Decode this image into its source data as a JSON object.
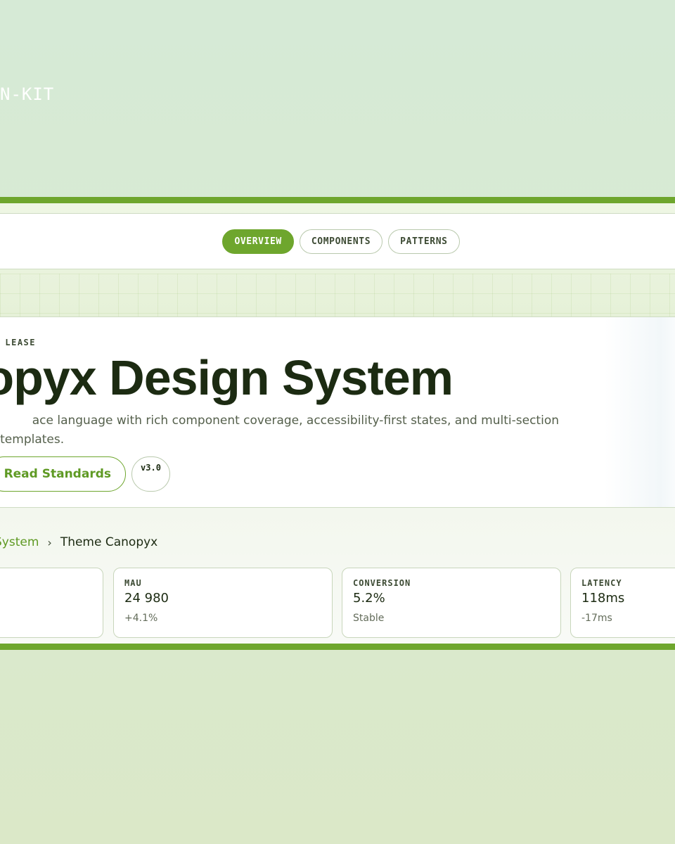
{
  "brand": {
    "kit_label": "N-KIT"
  },
  "nav": {
    "tabs": [
      {
        "label": "OVERVIEW",
        "active": true
      },
      {
        "label": "COMPONENTS",
        "active": false
      },
      {
        "label": "PATTERNS",
        "active": false
      }
    ]
  },
  "hero": {
    "eyebrow": "LEASE",
    "title": "opyx Design System",
    "description_line1": "ace language with rich component coverage, accessibility-first states, and multi-section",
    "description_line2": "/ templates.",
    "cta_label": "Read Standards",
    "version": "v3.0"
  },
  "breadcrumb": {
    "parent": "System",
    "separator": "›",
    "current": "Theme Canopyx"
  },
  "metrics": [
    {
      "label": "",
      "value": "",
      "delta": ""
    },
    {
      "label": "MAU",
      "value": "24 980",
      "delta": "+4.1%"
    },
    {
      "label": "CONVERSION",
      "value": "5.2%",
      "delta": "Stable"
    },
    {
      "label": "LATENCY",
      "value": "118ms",
      "delta": "-17ms"
    }
  ],
  "colors": {
    "accent": "#6ea62d",
    "accent_text": "#5f9a24",
    "ink": "#1c2b12",
    "muted": "#55604c",
    "border": "#c8d6bb"
  }
}
